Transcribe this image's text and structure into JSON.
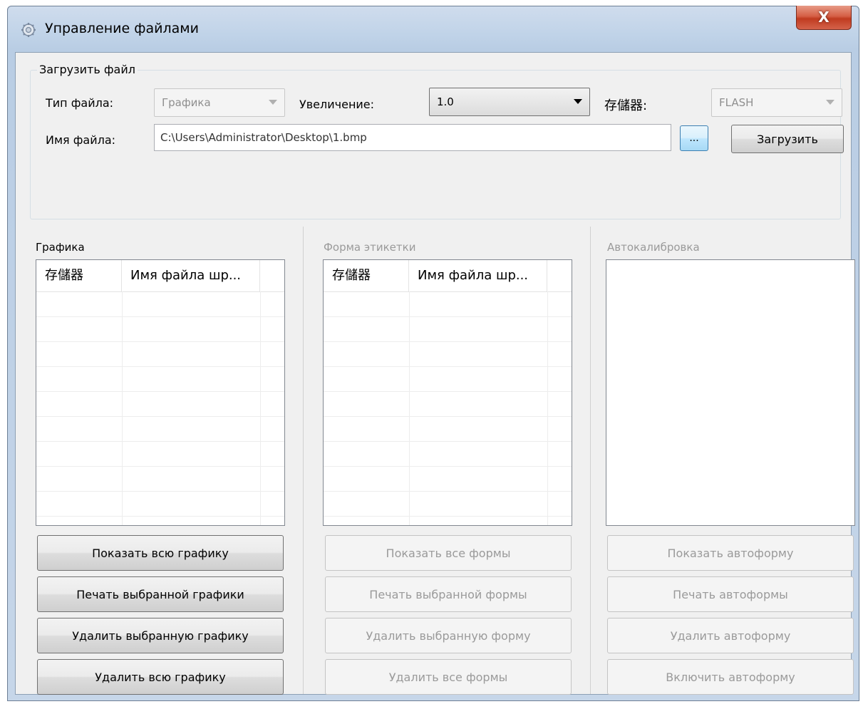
{
  "window": {
    "title": "Управление файлами",
    "close_label": "X"
  },
  "load": {
    "group_label": "Загрузить файл",
    "file_type_label": "Тип файла:",
    "file_type_value": "Графика",
    "zoom_label": "Увеличение:",
    "zoom_value": "1.0",
    "storage_label": "存儲器:",
    "storage_value": "FLASH",
    "filename_label": "Имя файла:",
    "filename_value": "C:\\Users\\Administrator\\Desktop\\1.bmp",
    "browse_label": "...",
    "upload_label": "Загрузить"
  },
  "graphics": {
    "title": "Графика",
    "columns": [
      "存儲器",
      "Имя файла шр..."
    ],
    "buttons": [
      "Показать всю графику",
      "Печать выбранной графики",
      "Удалить выбранную графику",
      "Удалить всю графику"
    ]
  },
  "label_form": {
    "title": "Форма этикетки",
    "columns": [
      "存儲器",
      "Имя файла шр..."
    ],
    "buttons": [
      "Показать все формы",
      "Печать выбранной формы",
      "Удалить выбранную форму",
      "Удалить все формы"
    ]
  },
  "autocal": {
    "title": "Автокалибровка",
    "buttons": [
      "Показать автоформу",
      "Печать автоформы",
      "Удалить автоформу",
      "Включить автоформу"
    ]
  }
}
